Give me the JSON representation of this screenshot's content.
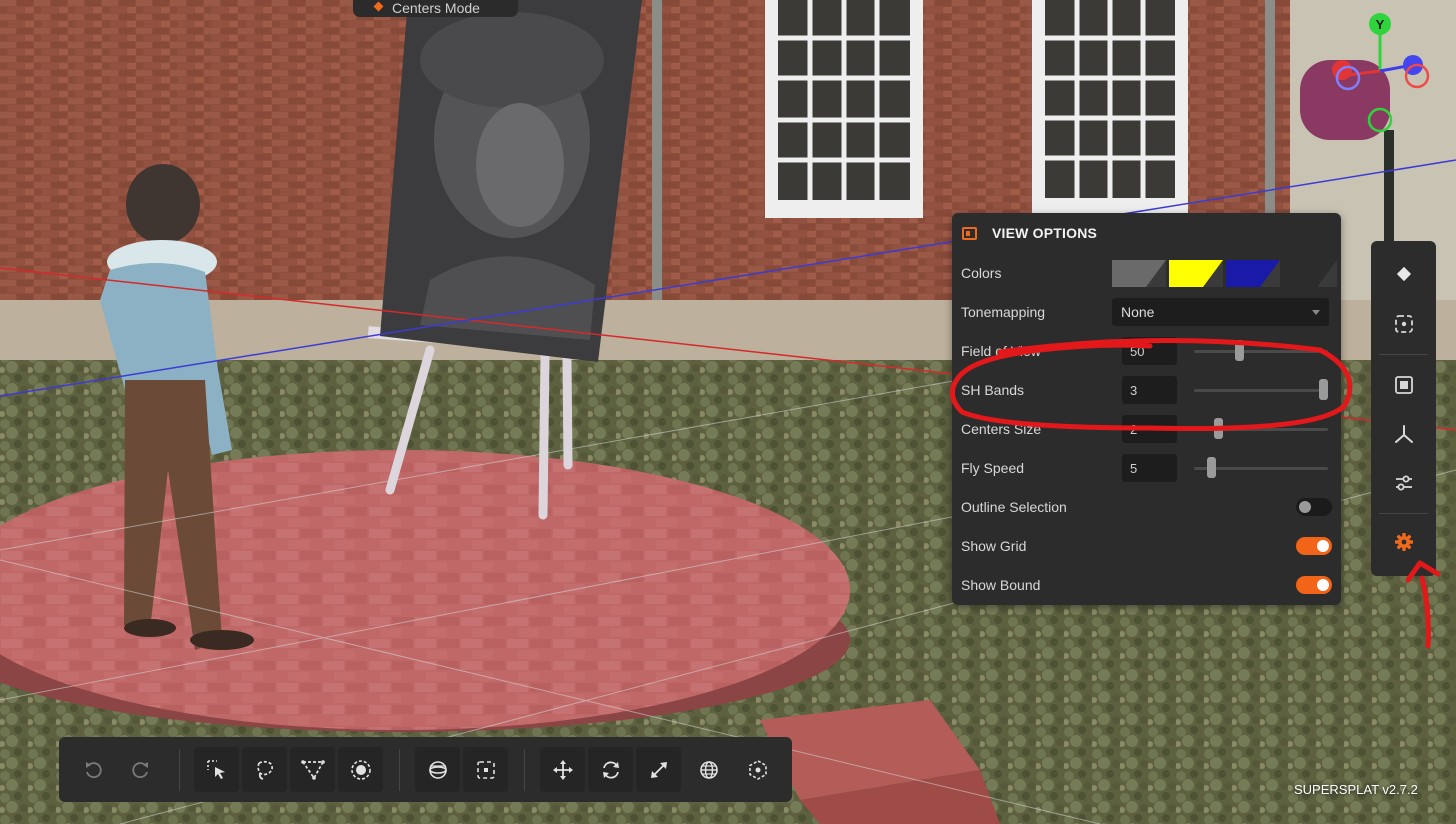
{
  "mode_pill": {
    "label": "Centers Mode"
  },
  "view_options": {
    "title": "VIEW OPTIONS",
    "colors": {
      "label": "Colors",
      "swatches": [
        "#6a6a6a",
        "#ffff00",
        "#1a1aa8",
        "#2c2c2c"
      ]
    },
    "tonemapping": {
      "label": "Tonemapping",
      "value": "None"
    },
    "field_of_view": {
      "label": "Field of View",
      "value": "50",
      "level": 0.33
    },
    "sh_bands": {
      "label": "SH Bands",
      "value": "3",
      "level": 1.0
    },
    "centers_size": {
      "label": "Centers Size",
      "value": "2",
      "level": 0.16
    },
    "fly_speed": {
      "label": "Fly Speed",
      "value": "5",
      "level": 0.1
    },
    "outline_selection": {
      "label": "Outline Selection",
      "on": false
    },
    "show_grid": {
      "label": "Show Grid",
      "on": true
    },
    "show_bound": {
      "label": "Show Bound",
      "on": true
    }
  },
  "side_toolbar": {
    "icons": [
      "diamond-icon",
      "focus-frame-icon",
      "select-frame-icon",
      "axes-icon",
      "sliders-icon",
      "gear-icon"
    ],
    "active": "gear-icon",
    "accent": "#f06a1e"
  },
  "bottom_toolbar": {
    "icons": [
      "undo-icon",
      "redo-icon",
      "pick-select-icon",
      "lasso-select-icon",
      "polygon-select-icon",
      "brush-select-icon",
      "sphere-select-icon",
      "box-select-icon",
      "move-icon",
      "rotate-icon",
      "scale-icon",
      "world-space-icon",
      "local-space-icon"
    ]
  },
  "gizmo": {
    "y_label": "Y"
  },
  "version": "SUPERSPLAT v2.7.2"
}
